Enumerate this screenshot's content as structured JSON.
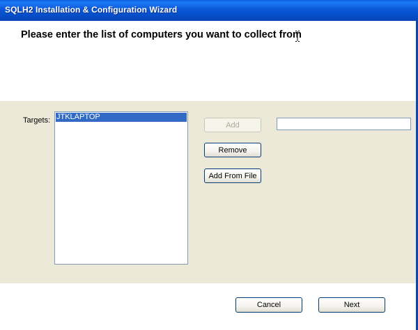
{
  "window": {
    "title": "SQLH2 Installation & Configuration Wizard"
  },
  "header": {
    "heading": "Please enter the list of computers you want to collect from"
  },
  "targets": {
    "label": "Targets:",
    "items": [
      "JTKLAPTOP"
    ],
    "selected_index": 0
  },
  "actions": {
    "add_label": "Add",
    "remove_label": "Remove",
    "add_from_file_label": "Add From File",
    "computer_input_value": ""
  },
  "footer": {
    "cancel_label": "Cancel",
    "next_label": "Next"
  },
  "colors": {
    "titlebar": "#0A58D8",
    "selection": "#316AC5",
    "panel": "#ECE9D8"
  }
}
